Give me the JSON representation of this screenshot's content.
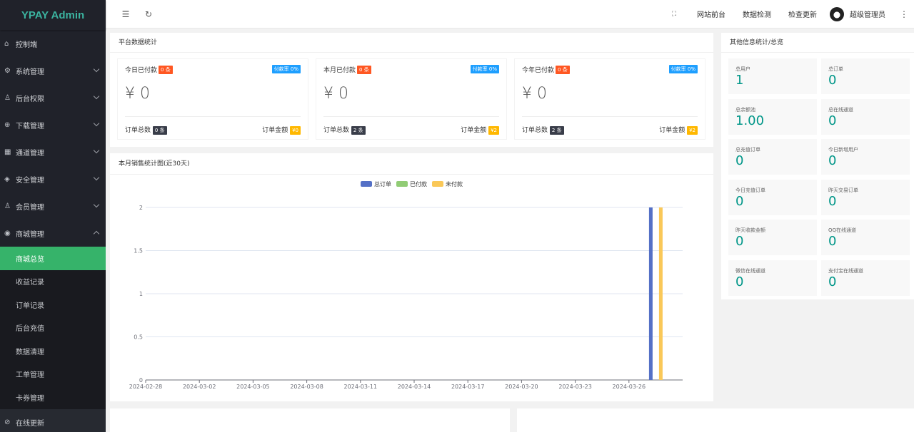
{
  "app": {
    "title": "YPAY Admin"
  },
  "sidebar": {
    "items": [
      {
        "label": "控制端",
        "icon": "home-icon",
        "glyph": "⌂",
        "chevron": ""
      },
      {
        "label": "系统管理",
        "icon": "gear-icon",
        "glyph": "⚙",
        "chevron": "down"
      },
      {
        "label": "后台权限",
        "icon": "user-icon",
        "glyph": "♙",
        "chevron": "down"
      },
      {
        "label": "下载管理",
        "icon": "download-icon",
        "glyph": "⊕",
        "chevron": "down"
      },
      {
        "label": "通道管理",
        "icon": "grid-icon",
        "glyph": "▦",
        "chevron": "down"
      },
      {
        "label": "安全管理",
        "icon": "diamond-icon",
        "glyph": "◈",
        "chevron": "down"
      },
      {
        "label": "会员管理",
        "icon": "user-icon",
        "glyph": "♙",
        "chevron": "down"
      },
      {
        "label": "商城管理",
        "icon": "shop-icon",
        "glyph": "◉",
        "chevron": "up"
      }
    ],
    "sub_items": [
      {
        "label": "商城总览",
        "active": true
      },
      {
        "label": "收益记录",
        "active": false
      },
      {
        "label": "订单记录",
        "active": false
      },
      {
        "label": "后台充值",
        "active": false
      },
      {
        "label": "数据清理",
        "active": false
      },
      {
        "label": "工单管理",
        "active": false
      },
      {
        "label": "卡券管理",
        "active": false
      }
    ],
    "bottom_item": {
      "label": "在线更新",
      "icon": "check-circle-icon",
      "glyph": "⊘"
    }
  },
  "header": {
    "links": [
      "网站前台",
      "数据检测",
      "检查更新"
    ],
    "user": "超级管理员"
  },
  "stats": {
    "title": "平台数据统计",
    "boxes": [
      {
        "label": "今日已付款",
        "count_badge": "0 条",
        "rate_badge": "付款率 0%",
        "amount": "¥ 0",
        "orders_label": "订单总数",
        "orders": "0 条",
        "money_label": "订单金额",
        "money": "¥0"
      },
      {
        "label": "本月已付款",
        "count_badge": "0 条",
        "rate_badge": "付款率 0%",
        "amount": "¥ 0",
        "orders_label": "订单总数",
        "orders": "2 条",
        "money_label": "订单金额",
        "money": "¥2"
      },
      {
        "label": "今年已付款",
        "count_badge": "0 条",
        "rate_badge": "付款率 0%",
        "amount": "¥ 0",
        "orders_label": "订单总数",
        "orders": "2 条",
        "money_label": "订单金额",
        "money": "¥2"
      }
    ]
  },
  "chart_title": "本月销售统计图(近30天)",
  "chart_data": {
    "type": "bar",
    "categories": [
      "2024-02-28",
      "2024-02-29",
      "2024-03-01",
      "2024-03-02",
      "2024-03-03",
      "2024-03-04",
      "2024-03-05",
      "2024-03-06",
      "2024-03-07",
      "2024-03-08",
      "2024-03-09",
      "2024-03-10",
      "2024-03-11",
      "2024-03-12",
      "2024-03-13",
      "2024-03-14",
      "2024-03-15",
      "2024-03-16",
      "2024-03-17",
      "2024-03-18",
      "2024-03-19",
      "2024-03-20",
      "2024-03-21",
      "2024-03-22",
      "2024-03-23",
      "2024-03-24",
      "2024-03-25",
      "2024-03-26",
      "2024-03-27",
      "2024-03-28"
    ],
    "tick_labels": [
      "2024-02-28",
      "2024-03-02",
      "2024-03-05",
      "2024-03-08",
      "2024-03-11",
      "2024-03-14",
      "2024-03-17",
      "2024-03-20",
      "2024-03-23",
      "2024-03-26"
    ],
    "series": [
      {
        "name": "总订单",
        "color": "#5470c6",
        "values": [
          0,
          0,
          0,
          0,
          0,
          0,
          0,
          0,
          0,
          0,
          0,
          0,
          0,
          0,
          0,
          0,
          0,
          0,
          0,
          0,
          0,
          0,
          0,
          0,
          0,
          0,
          0,
          0,
          2,
          0
        ]
      },
      {
        "name": "已付款",
        "color": "#91cc75",
        "values": [
          0,
          0,
          0,
          0,
          0,
          0,
          0,
          0,
          0,
          0,
          0,
          0,
          0,
          0,
          0,
          0,
          0,
          0,
          0,
          0,
          0,
          0,
          0,
          0,
          0,
          0,
          0,
          0,
          0,
          0
        ]
      },
      {
        "name": "未付款",
        "color": "#fac858",
        "values": [
          0,
          0,
          0,
          0,
          0,
          0,
          0,
          0,
          0,
          0,
          0,
          0,
          0,
          0,
          0,
          0,
          0,
          0,
          0,
          0,
          0,
          0,
          0,
          0,
          0,
          0,
          0,
          0,
          2,
          0
        ]
      }
    ],
    "yticks": [
      "0",
      "0.5",
      "1",
      "1.5",
      "2"
    ],
    "ylim": [
      0,
      2
    ],
    "legend_position": "top-center",
    "grid": true
  },
  "other": {
    "title": "其他信息统计/总览",
    "items": [
      {
        "label": "总用户",
        "value": "1"
      },
      {
        "label": "总订单",
        "value": "0"
      },
      {
        "label": "总余额池",
        "value": "1.00"
      },
      {
        "label": "总在线通道",
        "value": "0"
      },
      {
        "label": "总充值订单",
        "value": "0"
      },
      {
        "label": "今日新增用户",
        "value": "0"
      },
      {
        "label": "今日充值订单",
        "value": "0"
      },
      {
        "label": "昨天交易订单",
        "value": "0"
      },
      {
        "label": "昨天收款金额",
        "value": "0"
      },
      {
        "label": "QQ在线通道",
        "value": "0"
      },
      {
        "label": "微信在线通道",
        "value": "0"
      },
      {
        "label": "支付宝在线通道",
        "value": "0"
      }
    ]
  }
}
